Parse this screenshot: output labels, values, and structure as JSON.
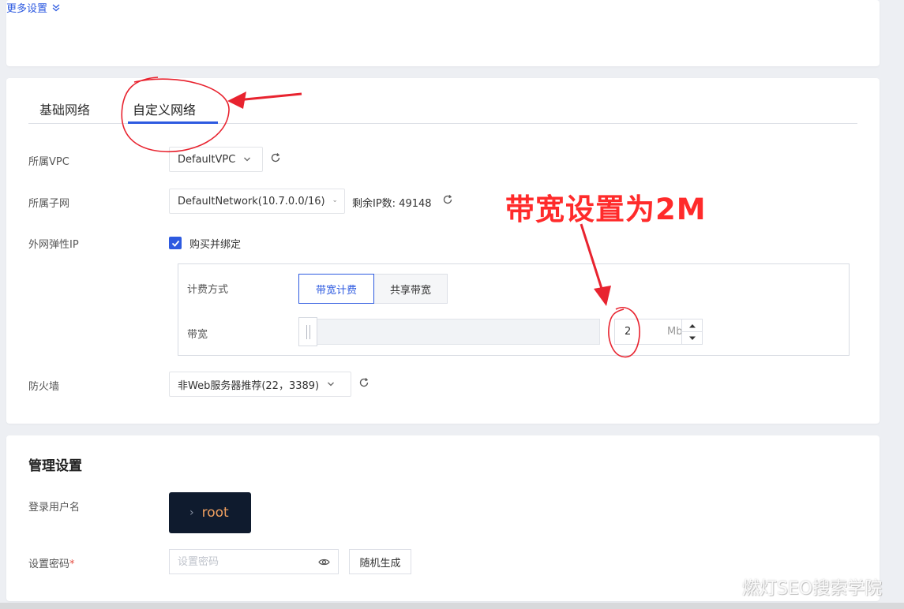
{
  "top": {
    "more_settings_label": "更多设置"
  },
  "network": {
    "tabs": [
      {
        "label": "基础网络",
        "active": false
      },
      {
        "label": "自定义网络",
        "active": true
      }
    ],
    "vpc": {
      "label": "所属VPC",
      "value": "DefaultVPC"
    },
    "subnet": {
      "label": "所属子网",
      "value": "DefaultNetwork(10.7.0.0/16)",
      "remaining_ip": "剩余IP数: 49148"
    },
    "eip": {
      "label": "外网弹性IP",
      "buy_bind_label": "购买并绑定",
      "buy_bind_checked": true,
      "billing_label": "计费方式",
      "billing_options": [
        "带宽计费",
        "共享带宽"
      ],
      "billing_selected": "带宽计费",
      "bandwidth_label": "带宽",
      "bandwidth_value": "2",
      "bandwidth_unit": "Mb"
    },
    "firewall": {
      "label": "防火墙",
      "value": "非Web服务器推荐(22，3389)"
    }
  },
  "annotation": {
    "text": "带宽设置为2M",
    "color": "#ff2b2b"
  },
  "admin": {
    "title": "管理设置",
    "login_user_label": "登录用户名",
    "login_user_prompt": "›",
    "login_user_value": "root",
    "password_label": "设置密码",
    "password_required_mark": "*",
    "password_placeholder": "设置密码",
    "random_button_label": "随机生成"
  },
  "watermark": "燃灯SEO搜索学院",
  "colors": {
    "accent": "#2d5ae0",
    "background": "#edeff3",
    "terminal_bg": "#0f1b2e"
  }
}
